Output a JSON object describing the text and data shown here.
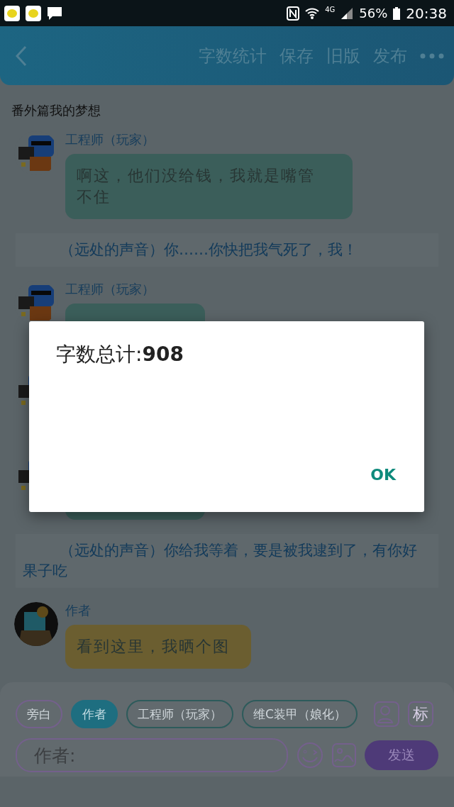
{
  "status_bar": {
    "network": "4G",
    "battery": "56%",
    "time": "20:38"
  },
  "toolbar": {
    "actions": [
      "字数统计",
      "保存",
      "旧版",
      "发布"
    ]
  },
  "story_title": "番外篇我的梦想",
  "messages": [
    {
      "kind": "engineer",
      "name": "工程师（玩家）",
      "text": "啊这，他们没给钱，我就是嘴管不住",
      "color": "#3b5e5a"
    },
    {
      "kind": "narration",
      "text": "（远处的声音）你……你快把我气死了，我！"
    },
    {
      "kind": "engineer",
      "name": "工程师（玩家）",
      "color": "#3b5e5a"
    },
    {
      "kind": "engineer"
    },
    {
      "kind": "engineer",
      "color": "#3b5e5a"
    },
    {
      "kind": "narration",
      "text": "（远处的声音）你给我等着，要是被我逮到了，有你好果子吃"
    },
    {
      "kind": "author",
      "name": "作者",
      "text": "看到这里，我晒个图",
      "color": "#6b5e30"
    }
  ],
  "roles": [
    {
      "label": "旁白",
      "selected": false,
      "color": "#74608c"
    },
    {
      "label": "作者",
      "selected": true,
      "color": "#1e6e80"
    },
    {
      "label": "工程师（玩家）",
      "selected": false,
      "color": "#2d5b5b"
    },
    {
      "label": "维C装甲（娘化）",
      "selected": false,
      "color": "#2d5b5b"
    }
  ],
  "mark_button": "标",
  "input": {
    "value": "作者:"
  },
  "send_button": "发送",
  "dialog": {
    "message": "字数总计:**908**",
    "button": "OK"
  }
}
